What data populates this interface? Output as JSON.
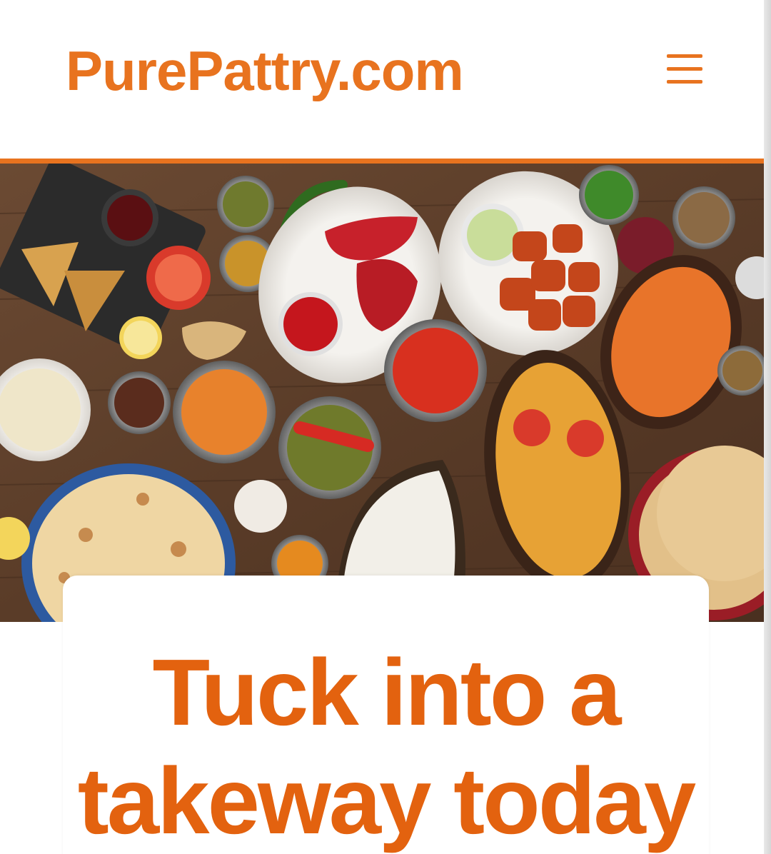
{
  "header": {
    "logo_text": "PurePattry.com",
    "menu_icon": "hamburger-menu-icon"
  },
  "hero": {
    "image_subject": "indian-food-spread"
  },
  "headline": {
    "line1": "Tuck into a",
    "line2": "takeway today"
  },
  "colors": {
    "brand_orange": "#E8731F",
    "headline_orange": "#E3620F",
    "background": "#ffffff"
  }
}
